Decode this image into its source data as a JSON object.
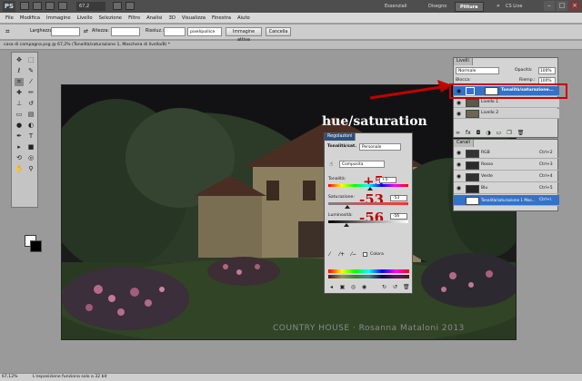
{
  "titlebar": {
    "logo": "PS",
    "zoom": "67,2",
    "workspaces": [
      "Essenziali",
      "Disegno",
      "Pittura"
    ],
    "cs_live": "CS Live"
  },
  "menu": [
    "File",
    "Modifica",
    "Immagine",
    "Livello",
    "Selezione",
    "Filtro",
    "Analisi",
    "3D",
    "Visualizza",
    "Finestra",
    "Aiuto"
  ],
  "options": {
    "width_label": "Larghezza:",
    "height_label": "Altezza:",
    "resolution_label": "Risoluz.:",
    "resolution_unit": "pixel/pollice",
    "front_image_button": "Immagine attiva",
    "clear_button": "Cancella"
  },
  "document": {
    "tab_label": "casa di campagna.psg @ 67,2% (Tonalità/saturazione 1, Maschera di livello/8) *",
    "watermark": "COUNTRY HOUSE · Rosanna Mataloni 2013"
  },
  "status": {
    "zoom": "67,12%",
    "text": "L'esposizione funziona solo a 32 bit"
  },
  "annotation": {
    "hue_label": "hue/saturation",
    "hue_value": "+5",
    "saturation_value": "-53",
    "lightness_value": "-56"
  },
  "layers_panel": {
    "tab": "Livelli",
    "blend_mode": "Normale",
    "opacity_label": "Opacità:",
    "opacity_value": "100%",
    "lock_label": "Blocca:",
    "fill_label": "Riemp.:",
    "fill_value": "100%",
    "layers": [
      {
        "name": "Tonalità/saturazione..."
      },
      {
        "name": "Livello 1"
      },
      {
        "name": "Livello 2"
      }
    ]
  },
  "channels_panel": {
    "tab": "Canali",
    "channels": [
      {
        "name": "RGB",
        "shortcut": "Ctrl+2"
      },
      {
        "name": "Rosso",
        "shortcut": "Ctrl+3"
      },
      {
        "name": "Verde",
        "shortcut": "Ctrl+4"
      },
      {
        "name": "Blu",
        "shortcut": "Ctrl+5"
      },
      {
        "name": "Tonalità/saturazione 1 Mas...",
        "shortcut": "Ctrl+\\"
      }
    ]
  },
  "adjust_panel": {
    "tab": "Regolazioni",
    "title": "Tonalità/sat.",
    "preset": "Personale",
    "channel": "Composita",
    "hue_label": "Tonalità:",
    "hue_field": "+5",
    "sat_label": "Saturazione:",
    "sat_field": "-53",
    "light_label": "Luminosità:",
    "light_field": "-56",
    "colorize_label": "Colora"
  },
  "colors": {
    "selection_blue": "#3471c9",
    "annotation_red": "#c10000",
    "highlight_box": "#cc0000"
  }
}
